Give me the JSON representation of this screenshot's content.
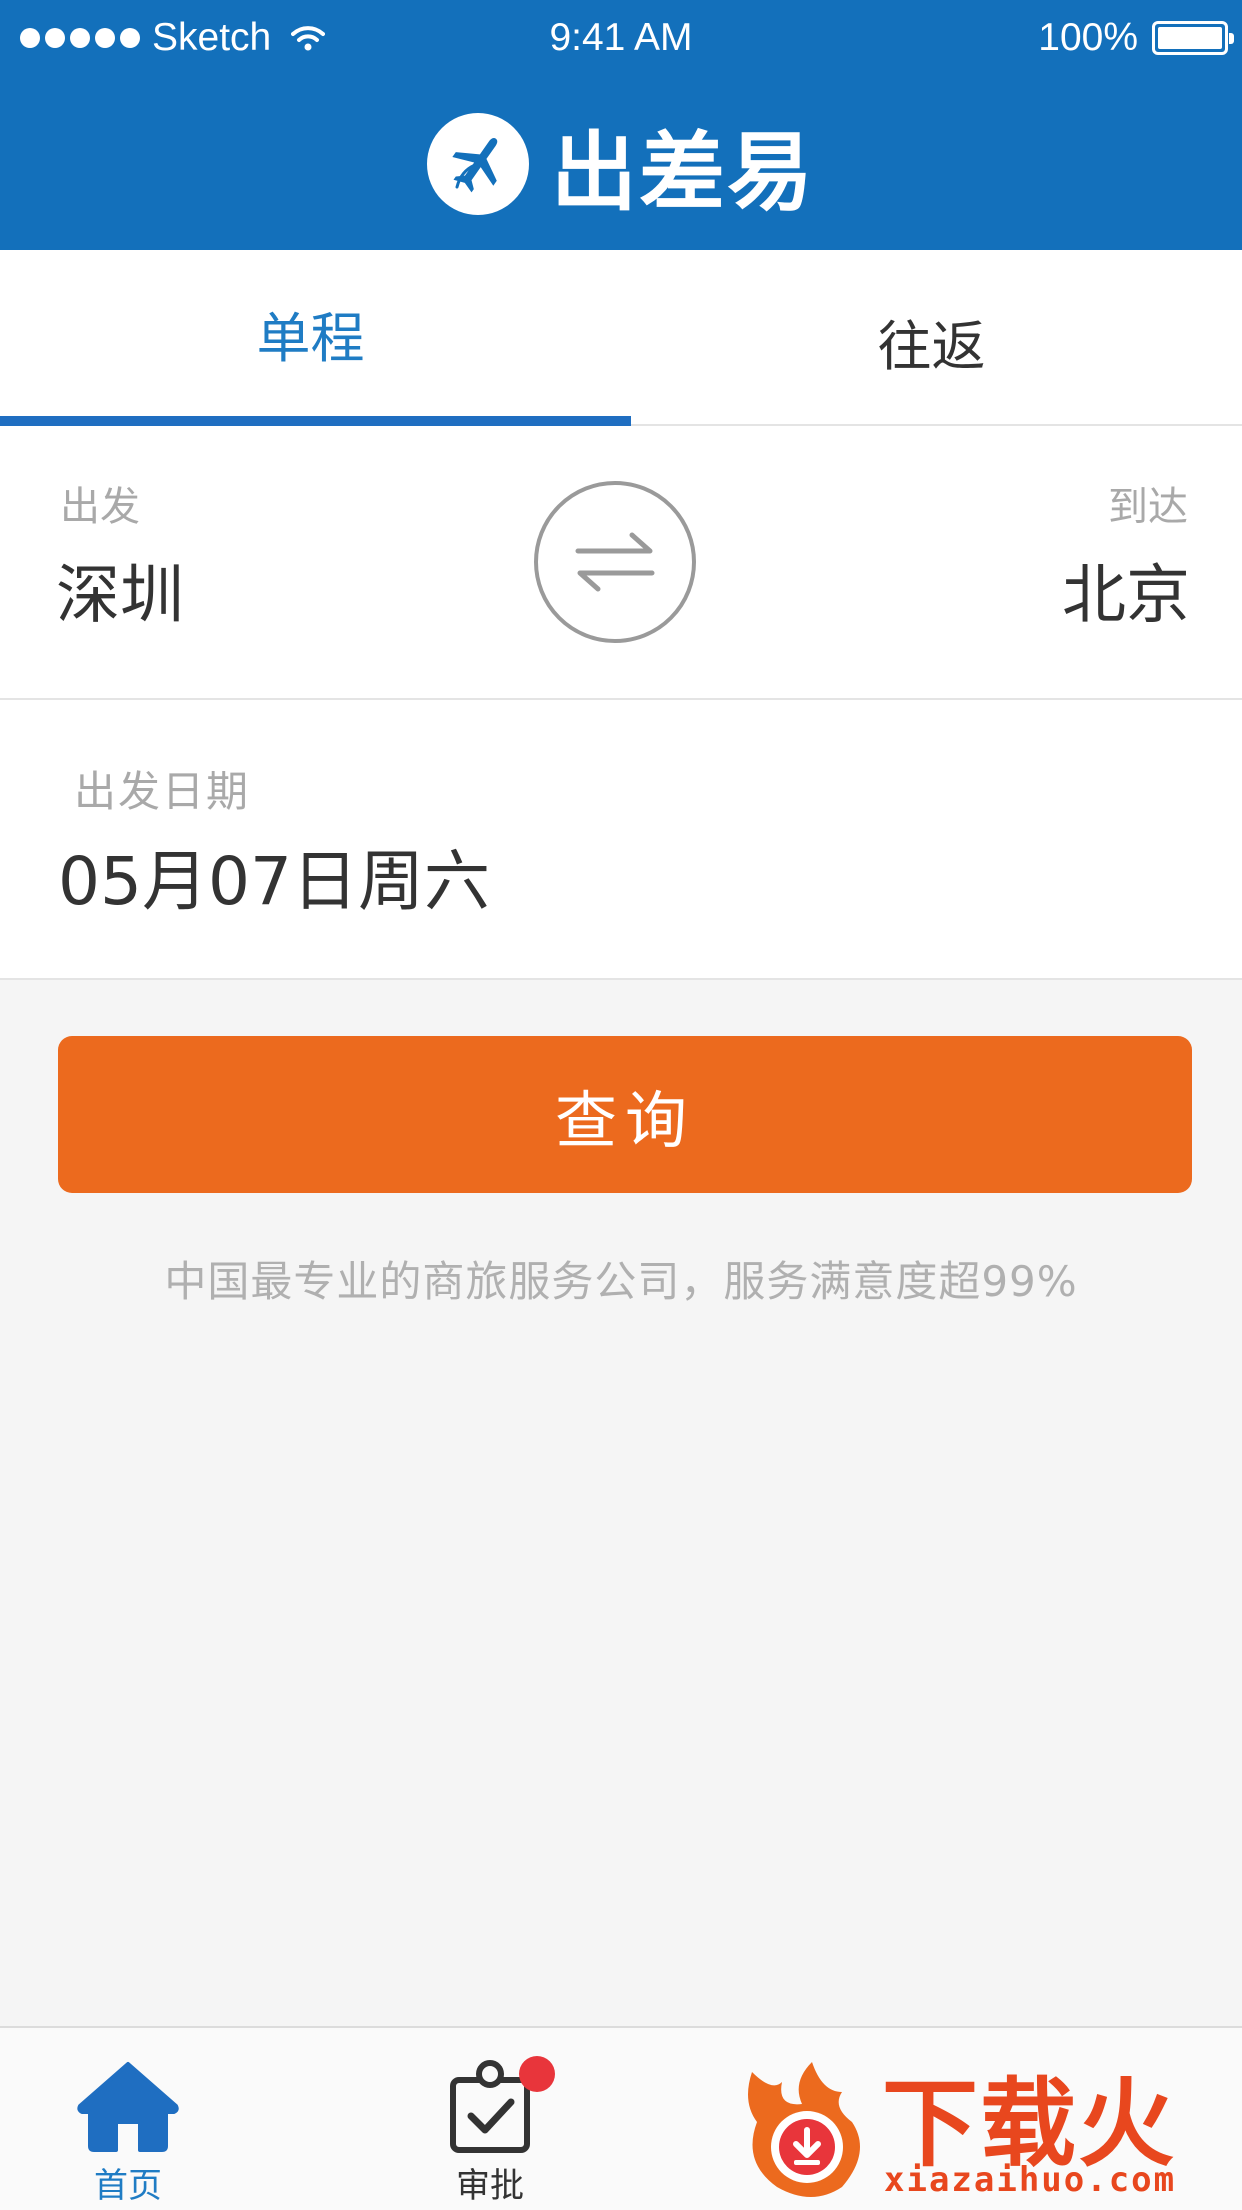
{
  "status_bar": {
    "carrier": "Sketch",
    "time": "9:41 AM",
    "battery": "100%"
  },
  "header": {
    "app_name": "出差易"
  },
  "tabs": [
    {
      "label": "单程",
      "active": true
    },
    {
      "label": "往返",
      "active": false
    }
  ],
  "route": {
    "from_label": "出发",
    "from_city": "深圳",
    "to_label": "到达",
    "to_city": "北京"
  },
  "date": {
    "label": "出发日期",
    "value": "05月07日周六"
  },
  "search": {
    "button_label": "查询",
    "slogan": "中国最专业的商旅服务公司，服务满意度超99%"
  },
  "bottom_nav": [
    {
      "label": "首页",
      "active": true
    },
    {
      "label": "审批",
      "active": false
    }
  ],
  "watermark": {
    "title": "下载火",
    "url": "xiazaihuo.com"
  },
  "colors": {
    "brand_blue": "#1370bb",
    "accent_orange": "#ec6a1e",
    "badge_red": "#e8353b"
  }
}
